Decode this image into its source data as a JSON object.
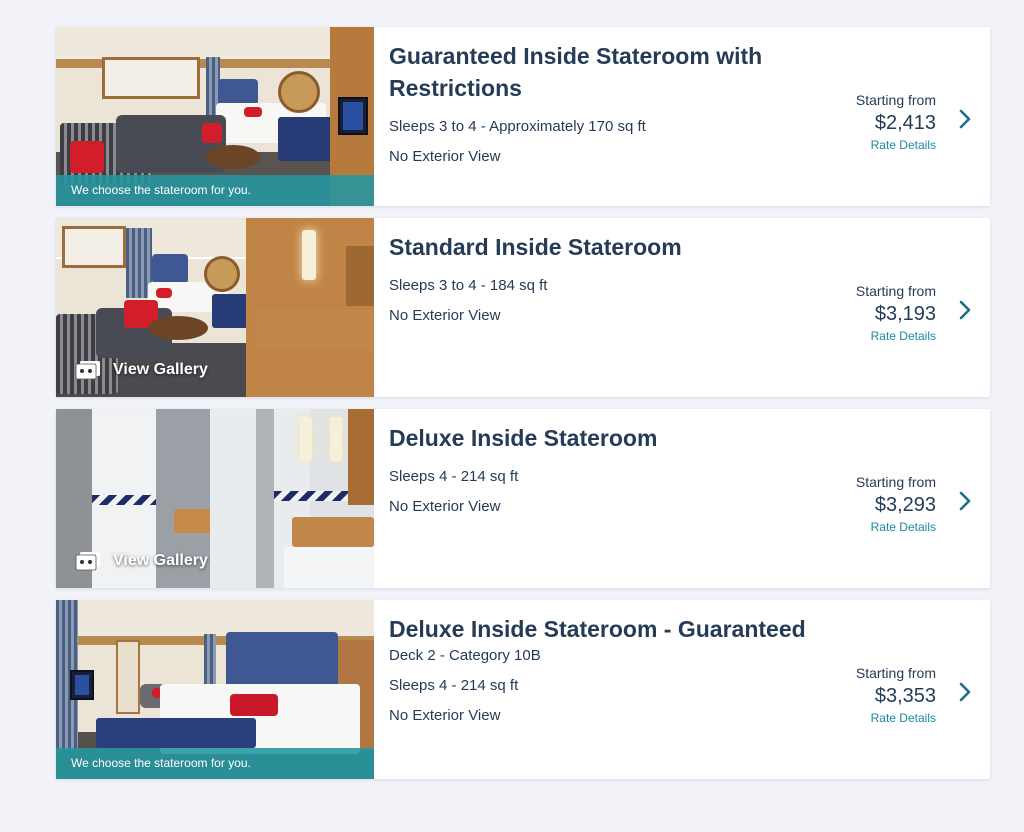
{
  "staterooms": [
    {
      "title": "Guaranteed Inside Stateroom with Restrictions",
      "detail": "",
      "sleeps": "Sleeps 3 to 4 - Approximately 170 sq ft",
      "view": "No Exterior View",
      "starting_label": "Starting from",
      "price": "$2,413",
      "rate_link": "Rate Details",
      "photo_caption": "We choose the stateroom for you."
    },
    {
      "title": "Standard Inside Stateroom",
      "sleeps": "Sleeps 3 to 4 - 184 sq ft",
      "view": "No Exterior View",
      "starting_label": "Starting from",
      "price": "$3,193",
      "rate_link": "Rate Details",
      "gallery_label": "View Gallery"
    },
    {
      "title": "Deluxe Inside Stateroom",
      "sleeps": "Sleeps 4 - 214 sq ft",
      "view": "No Exterior View",
      "starting_label": "Starting from",
      "price": "$3,293",
      "rate_link": "Rate Details",
      "gallery_label": "View Gallery"
    },
    {
      "title": "Deluxe Inside Stateroom - Guaranteed",
      "detail": "Deck 2 - Category 10B",
      "sleeps": "Sleeps 4 - 214 sq ft",
      "view": "No Exterior View",
      "starting_label": "Starting from",
      "price": "$3,353",
      "rate_link": "Rate Details",
      "photo_caption": "We choose the stateroom for you."
    }
  ],
  "icons": {
    "gallery": "photo-gallery-icon",
    "chevron": "chevron-right-icon"
  },
  "colors": {
    "background": "#f1f3f9",
    "text": "#253b56",
    "link": "#1b8aa0",
    "caption_bar": "#2496a0"
  }
}
